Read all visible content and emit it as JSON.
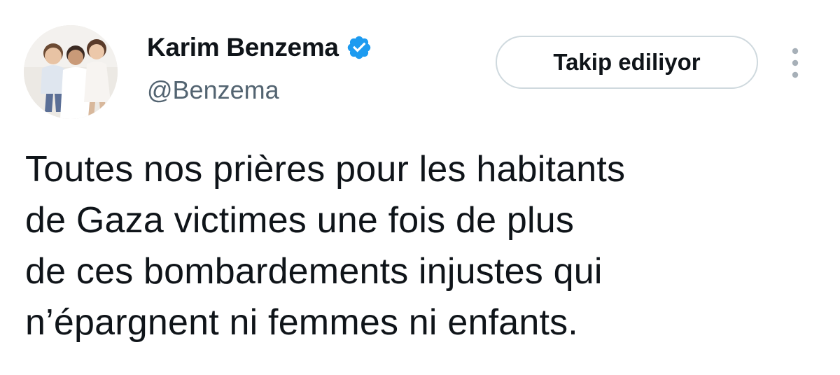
{
  "tweet": {
    "author": {
      "display_name": "Karim Benzema",
      "handle": "@Benzema",
      "verified": true,
      "verified_color": "#1d9bf0"
    },
    "follow_button_label": "Takip ediliyor",
    "more_icon": "more-vertical-icon",
    "text_lines": [
      "Toutes nos prières pour les habitants",
      "de Gaza victimes une fois de plus",
      "de ces bombardements injustes qui",
      "n’épargnent ni femmes ni enfants."
    ]
  },
  "colors": {
    "text_primary": "#0f1419",
    "text_secondary": "#536471",
    "button_border": "#cfd9de",
    "background": "#ffffff"
  }
}
